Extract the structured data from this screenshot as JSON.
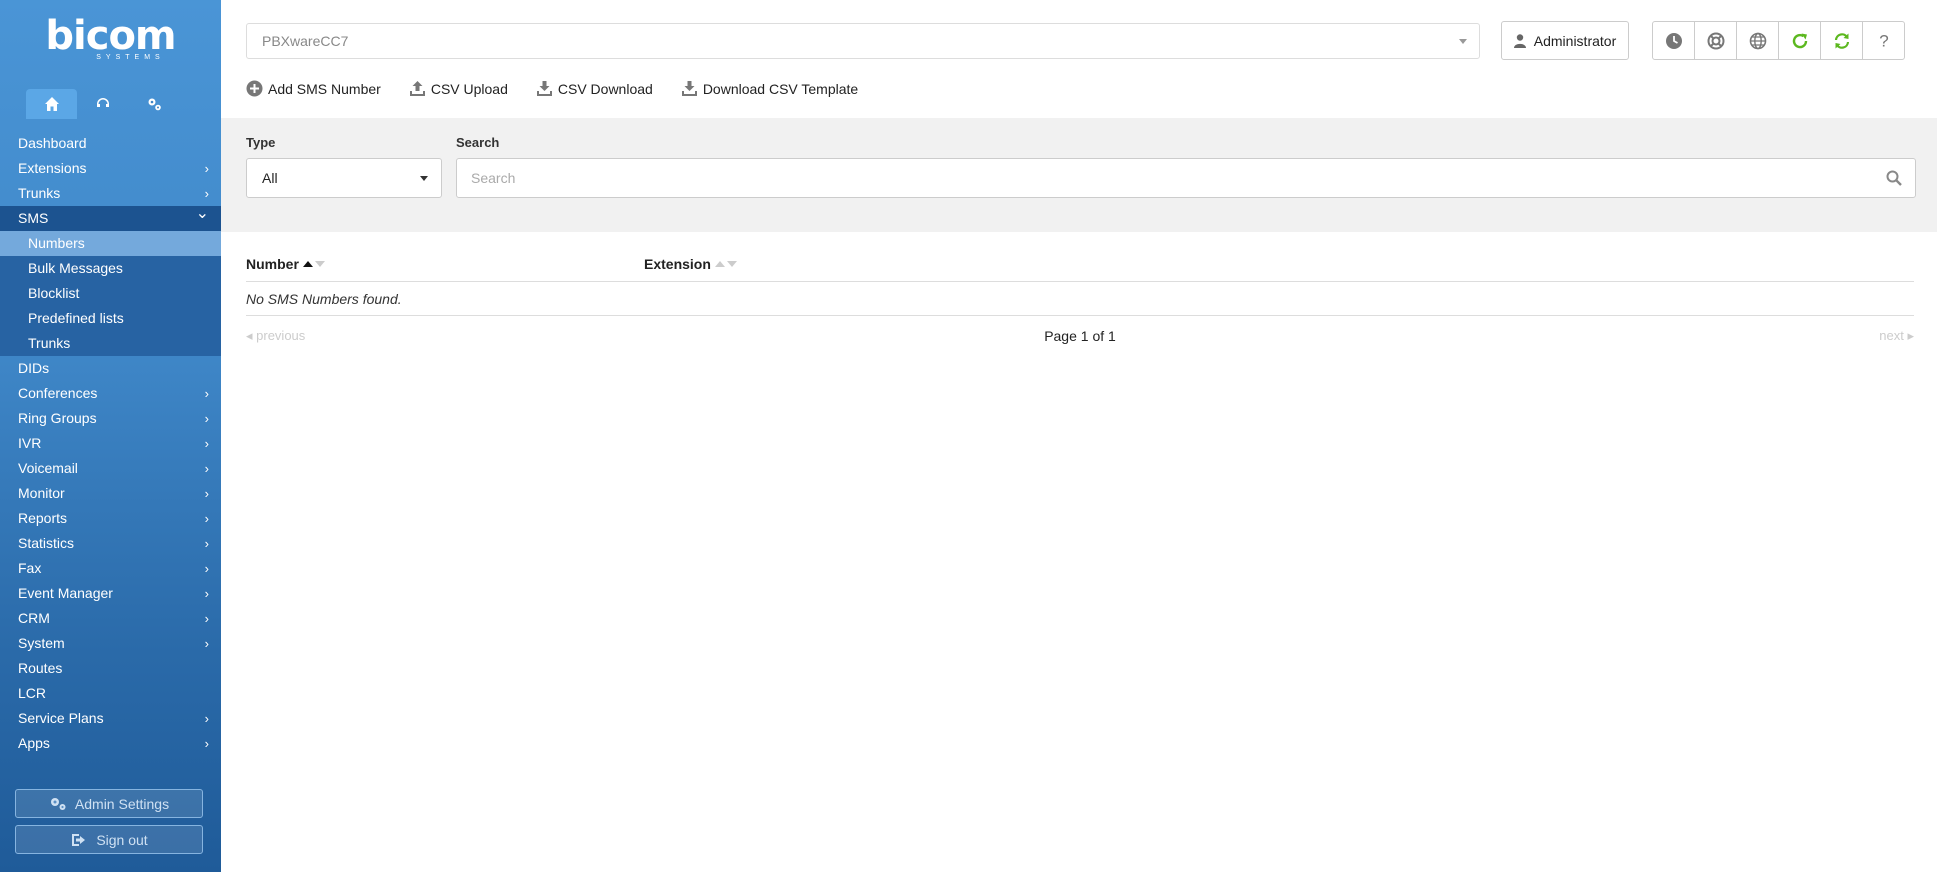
{
  "logo": {
    "brand": "bicom",
    "sub": "SYSTEMS"
  },
  "sidebar": {
    "tabs": [
      {
        "icon": "home-icon"
      },
      {
        "icon": "headset-icon"
      },
      {
        "icon": "gears-icon"
      }
    ],
    "items": [
      {
        "label": "Dashboard",
        "chevron": false
      },
      {
        "label": "Extensions",
        "chevron": true
      },
      {
        "label": "Trunks",
        "chevron": true
      },
      {
        "label": "SMS",
        "chevron": true,
        "open": true,
        "children": [
          "Numbers",
          "Bulk Messages",
          "Blocklist",
          "Predefined lists",
          "Trunks"
        ],
        "active_child": "Numbers"
      },
      {
        "label": "DIDs",
        "chevron": false
      },
      {
        "label": "Conferences",
        "chevron": true
      },
      {
        "label": "Ring Groups",
        "chevron": true
      },
      {
        "label": "IVR",
        "chevron": true
      },
      {
        "label": "Voicemail",
        "chevron": true
      },
      {
        "label": "Monitor",
        "chevron": true
      },
      {
        "label": "Reports",
        "chevron": true
      },
      {
        "label": "Statistics",
        "chevron": true
      },
      {
        "label": "Fax",
        "chevron": true
      },
      {
        "label": "Event Manager",
        "chevron": true
      },
      {
        "label": "CRM",
        "chevron": true
      },
      {
        "label": "System",
        "chevron": true
      },
      {
        "label": "Routes",
        "chevron": false
      },
      {
        "label": "LCR",
        "chevron": false
      },
      {
        "label": "Service Plans",
        "chevron": true
      },
      {
        "label": "Apps",
        "chevron": true
      }
    ],
    "admin_settings": "Admin Settings",
    "sign_out": "Sign out"
  },
  "header": {
    "server": "PBXwareCC7",
    "user": "Administrator",
    "icons": [
      "clock-icon",
      "lifebuoy-icon",
      "globe-icon",
      "refresh-icon",
      "sync-icon",
      "help-icon"
    ]
  },
  "toolbar": {
    "add": "Add SMS Number",
    "upload": "CSV Upload",
    "download": "CSV Download",
    "template": "Download CSV Template"
  },
  "filters": {
    "type_label": "Type",
    "type_value": "All",
    "search_label": "Search",
    "search_placeholder": "Search"
  },
  "table": {
    "columns": [
      "Number",
      "Extension"
    ],
    "empty": "No SMS Numbers found.",
    "pager": {
      "previous": "previous",
      "page": "Page 1 of 1",
      "next": "next"
    }
  },
  "colors": {
    "accent_green": "#5cb81f",
    "sidebar_blue": "#3f87c8"
  }
}
